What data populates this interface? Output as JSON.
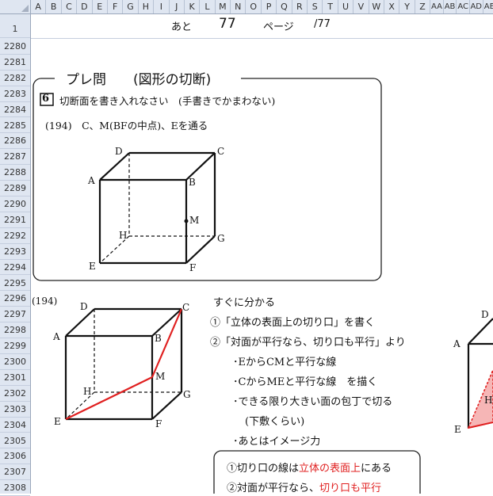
{
  "column_headers": [
    "A",
    "B",
    "C",
    "D",
    "E",
    "F",
    "G",
    "H",
    "I",
    "J",
    "K",
    "L",
    "M",
    "N",
    "O",
    "P",
    "Q",
    "R",
    "S",
    "T",
    "U",
    "V",
    "W",
    "X",
    "Y",
    "Z",
    "AA",
    "AB",
    "AC",
    "AD",
    "AE"
  ],
  "row_headers": [
    "1",
    "2280",
    "2281",
    "2282",
    "2283",
    "2284",
    "2285",
    "2286",
    "2287",
    "2288",
    "2289",
    "2290",
    "2291",
    "2292",
    "2293",
    "2294",
    "2295",
    "2296",
    "2297",
    "2298",
    "2299",
    "2300",
    "2301",
    "2302",
    "2303",
    "2304",
    "2305",
    "2306",
    "2307",
    "2308"
  ],
  "page_bar": {
    "label_ato": "あと",
    "page_number": "77",
    "label_page": "ページ",
    "total": "/77"
  },
  "problem_box": {
    "title": "プレ問　　(図形の切断)",
    "number": "6",
    "instruction": "切断面を書き入れなさい　(手書きでかまわない)",
    "question": "(194)　C、M(BFの中点)、Eを通る",
    "labels": {
      "A": "A",
      "B": "B",
      "C": "C",
      "D": "D",
      "E": "E",
      "F": "F",
      "G": "G",
      "H": "H",
      "M": "M"
    }
  },
  "solution": {
    "number": "(194)",
    "labels": {
      "A": "A",
      "B": "B",
      "C": "C",
      "D": "D",
      "E": "E",
      "F": "F",
      "G": "G",
      "H": "H",
      "M": "M"
    },
    "line_color": "#e02020"
  },
  "explanation": {
    "lines": [
      "すぐに分かる",
      "①「立体の表面上の切り口」を書く",
      "②「対面が平行なら、切り口も平行」より",
      "･EからCMと平行な線",
      "･CからMEと平行な線　を描く",
      "･できる限り大きい面の包丁で切る",
      "(下敷くらい)",
      "･あとはイメージ力"
    ]
  },
  "summary_box": {
    "line1_prefix": "①切り口の線は",
    "line1_red": "立体の表面上",
    "line1_suffix": "にある",
    "line2_prefix": "②対面が平行なら、",
    "line2_red": "切り口も平行"
  },
  "right_partial": {
    "D": "D",
    "A": "A",
    "E": "E",
    "H": "H"
  }
}
